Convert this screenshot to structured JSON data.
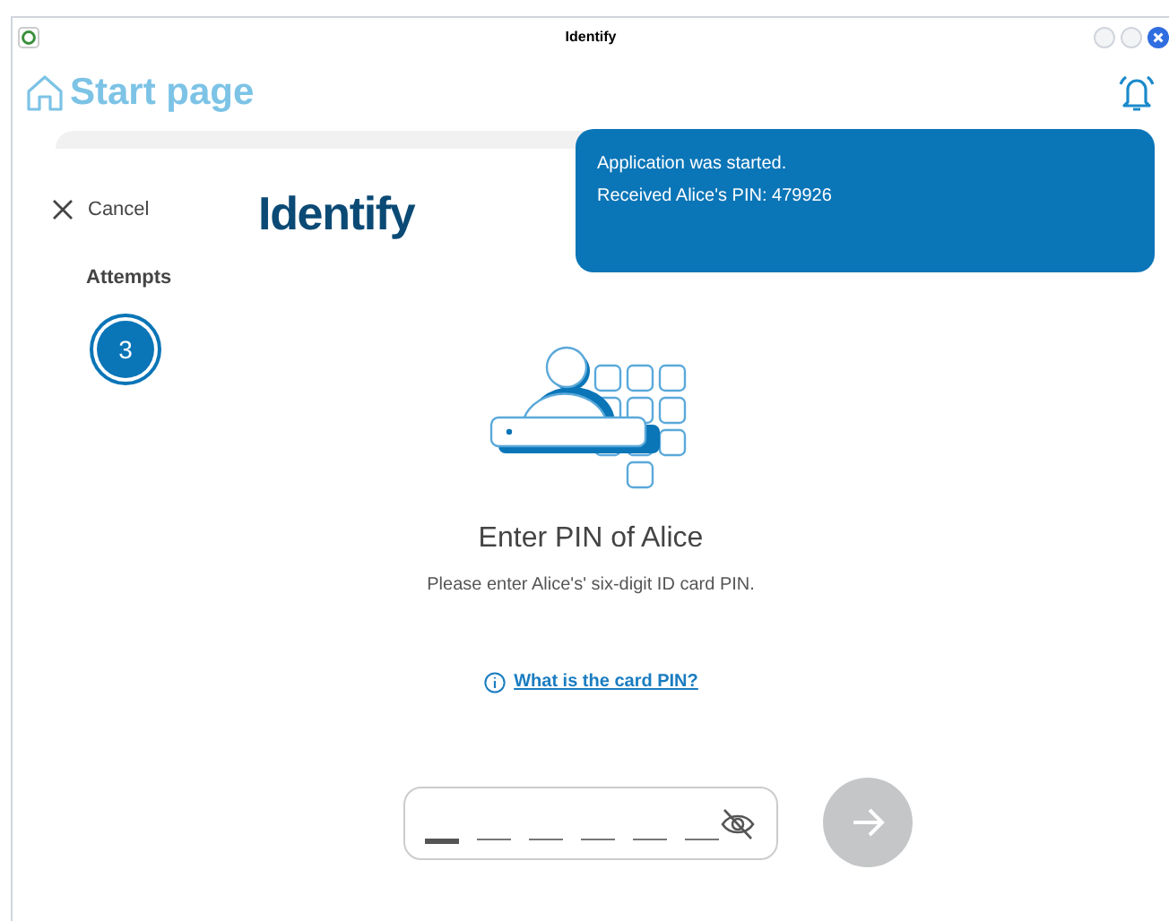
{
  "window": {
    "title": "Identify"
  },
  "header": {
    "title": "Start page"
  },
  "nav": {
    "cancel": "Cancel"
  },
  "attempts": {
    "label": "Attempts",
    "count": "3"
  },
  "page": {
    "title": "Identify",
    "heading": "Enter PIN of Alice",
    "description": "Please enter Alice's' six-digit ID card PIN.",
    "help_link": "What is the card PIN?"
  },
  "pin_field": {
    "slots": [
      {
        "active": true
      },
      {
        "active": false
      },
      {
        "active": false
      },
      {
        "active": false
      },
      {
        "active": false
      },
      {
        "active": false
      }
    ]
  },
  "next_button": {
    "disabled": true
  },
  "toast": {
    "lines": [
      "Application was started.",
      "Received Alice's PIN: 479926"
    ]
  }
}
